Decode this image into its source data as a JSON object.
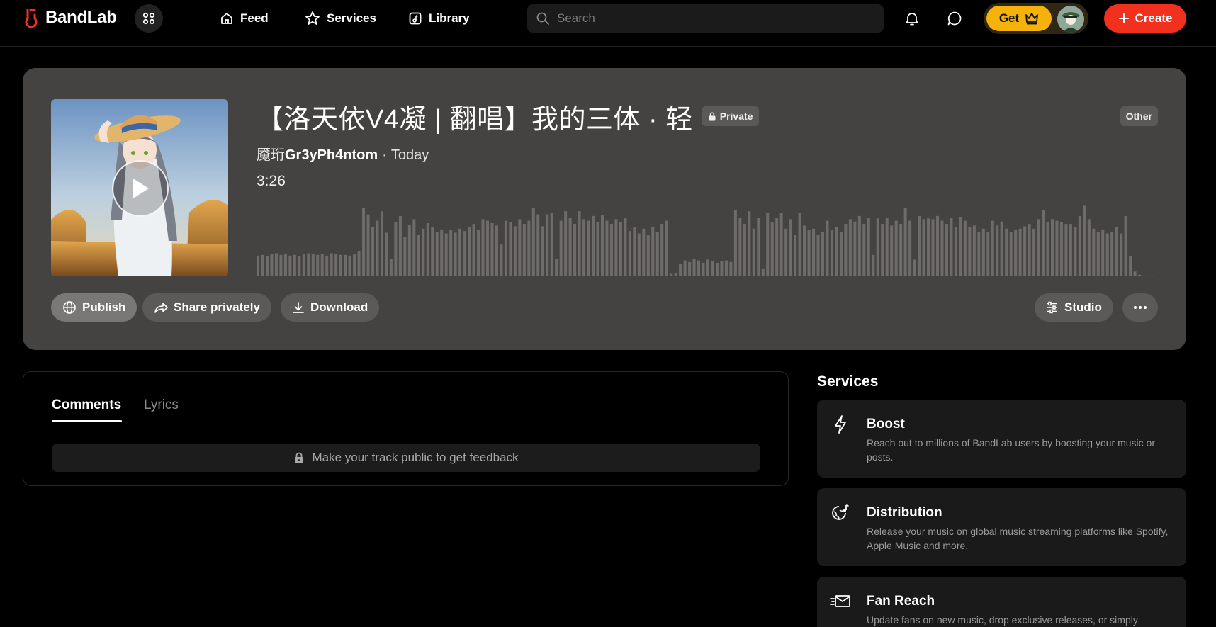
{
  "app": {
    "logo_text": "BandLab"
  },
  "nav": {
    "feed": "Feed",
    "services": "Services",
    "library": "Library"
  },
  "search": {
    "placeholder": "Search"
  },
  "header_actions": {
    "get_label": "Get",
    "create_label": "Create"
  },
  "track": {
    "title": "【洛天依V4凝 | 翻唱】我的三体 · 轻",
    "privacy": "Private",
    "genre": "Other",
    "artist_prefix": "魇珩",
    "artist": "Gr3yPh4ntom",
    "separator": "·",
    "date": "Today",
    "duration": "3:26",
    "waveform_levels": [
      0.26,
      0.27,
      0.25,
      0.28,
      0.29,
      0.27,
      0.28,
      0.26,
      0.27,
      0.25,
      0.28,
      0.29,
      0.28,
      0.27,
      0.28,
      0.26,
      0.29,
      0.28,
      0.27,
      0.27,
      0.26,
      0.28,
      0.32,
      0.86,
      0.78,
      0.62,
      0.7,
      0.82,
      0.55,
      0.22,
      0.68,
      0.76,
      0.5,
      0.65,
      0.72,
      0.52,
      0.6,
      0.67,
      0.62,
      0.56,
      0.59,
      0.54,
      0.58,
      0.55,
      0.6,
      0.57,
      0.62,
      0.66,
      0.58,
      0.72,
      0.7,
      0.67,
      0.64,
      0.4,
      0.7,
      0.68,
      0.63,
      0.72,
      0.66,
      0.7,
      0.86,
      0.78,
      0.63,
      0.78,
      0.8,
      0.22,
      0.7,
      0.82,
      0.74,
      0.66,
      0.82,
      0.72,
      0.7,
      0.76,
      0.68,
      0.77,
      0.7,
      0.66,
      0.72,
      0.68,
      0.74,
      0.57,
      0.62,
      0.54,
      0.6,
      0.52,
      0.62,
      0.56,
      0.66,
      0.7,
      0.03,
      0.04,
      0.16,
      0.2,
      0.18,
      0.22,
      0.2,
      0.17,
      0.21,
      0.19,
      0.17,
      0.19,
      0.2,
      0.18,
      0.84,
      0.74,
      0.66,
      0.82,
      0.6,
      0.74,
      0.1,
      0.8,
      0.68,
      0.74,
      0.8,
      0.6,
      0.72,
      0.52,
      0.8,
      0.64,
      0.58,
      0.6,
      0.52,
      0.56,
      0.7,
      0.58,
      0.62,
      0.56,
      0.66,
      0.72,
      0.69,
      0.76,
      0.66,
      0.74,
      0.27,
      0.73,
      0.66,
      0.74,
      0.64,
      0.7,
      0.66,
      0.86,
      0.7,
      0.21,
      0.76,
      0.72,
      0.73,
      0.72,
      0.76,
      0.7,
      0.66,
      0.74,
      0.62,
      0.75,
      0.7,
      0.62,
      0.64,
      0.56,
      0.6,
      0.56,
      0.7,
      0.64,
      0.69,
      0.6,
      0.56,
      0.59,
      0.6,
      0.63,
      0.66,
      0.6,
      0.72,
      0.84,
      0.68,
      0.72,
      0.7,
      0.68,
      0.66,
      0.66,
      0.62,
      0.76,
      0.89,
      0.72,
      0.6,
      0.56,
      0.59,
      0.54,
      0.56,
      0.62,
      0.54,
      0.76,
      0.26,
      0.06,
      0.02,
      0.01,
      0.01,
      0.01
    ]
  },
  "actions": {
    "publish": "Publish",
    "share": "Share privately",
    "download": "Download",
    "studio": "Studio"
  },
  "comments": {
    "tabs": [
      "Comments",
      "Lyrics"
    ],
    "notice": "Make your track public to get feedback"
  },
  "services": {
    "title": "Services",
    "items": [
      {
        "name": "Boost",
        "icon": "lightning-icon",
        "desc": "Reach out to millions of BandLab users by boosting your music or posts."
      },
      {
        "name": "Distribution",
        "icon": "globe-note-icon",
        "desc": "Release your music on global music streaming platforms like Spotify, Apple Music and more."
      },
      {
        "name": "Fan Reach",
        "icon": "fast-mail-icon",
        "desc": "Update fans on new music, drop exclusive releases, or simply"
      }
    ]
  },
  "colors": {
    "accent_red": "#f1311e",
    "gold": "#f5b20a",
    "card_bg": "#454341",
    "waveform_bar": "#6e6c6a"
  }
}
